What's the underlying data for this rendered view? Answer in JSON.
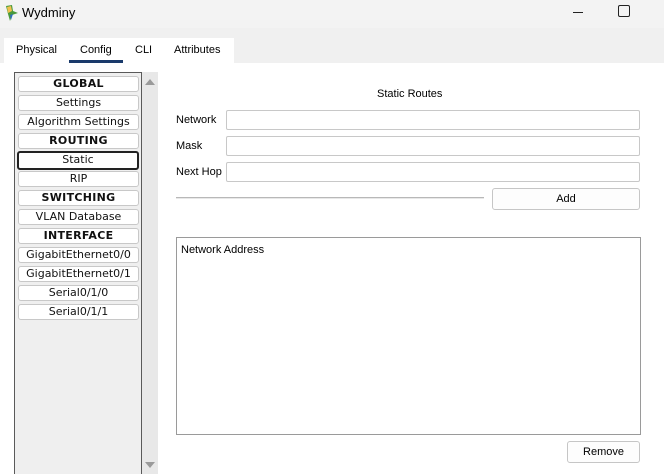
{
  "window": {
    "title": "Wydminy"
  },
  "tabs": [
    {
      "label": "Physical"
    },
    {
      "label": "Config",
      "active": true
    },
    {
      "label": "CLI"
    },
    {
      "label": "Attributes"
    }
  ],
  "sidebar": {
    "items": [
      {
        "label": "GLOBAL",
        "type": "header"
      },
      {
        "label": "Settings"
      },
      {
        "label": "Algorithm Settings"
      },
      {
        "label": "ROUTING",
        "type": "header"
      },
      {
        "label": "Static",
        "selected": true
      },
      {
        "label": "RIP"
      },
      {
        "label": "SWITCHING",
        "type": "header"
      },
      {
        "label": "VLAN Database"
      },
      {
        "label": "INTERFACE",
        "type": "header"
      },
      {
        "label": "GigabitEthernet0/0"
      },
      {
        "label": "GigabitEthernet0/1"
      },
      {
        "label": "Serial0/1/0"
      },
      {
        "label": "Serial0/1/1"
      }
    ]
  },
  "static_routes": {
    "title": "Static Routes",
    "network_label": "Network",
    "network_value": "",
    "mask_label": "Mask",
    "mask_value": "",
    "next_hop_label": "Next Hop",
    "next_hop_value": "",
    "add_label": "Add",
    "list_header": "Network Address",
    "remove_label": "Remove"
  },
  "colors": {
    "tab_underline": "#1a3a6b",
    "sidebar_bg": "#efefef"
  },
  "icons": {
    "app": "packet-tracer-router-icon",
    "minimize": "minimize-icon",
    "maximize": "maximize-icon"
  }
}
